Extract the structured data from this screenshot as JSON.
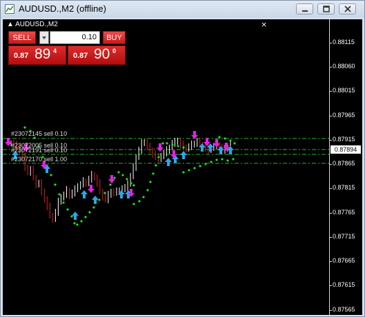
{
  "window": {
    "title": "AUDUSD.,M2 (offline)"
  },
  "chart": {
    "symbol_label": "AUDUSD.,M2",
    "close_glyph": "×",
    "panel": {
      "sell_label": "SELL",
      "buy_label": "BUY",
      "lot_value": "0.10",
      "bid": {
        "prefix": "0.87",
        "big": "89",
        "sup": "4"
      },
      "ask": {
        "prefix": "0.87",
        "big": "90",
        "sup": "0"
      }
    },
    "price_ticks": [
      "0.88115",
      "0.88060",
      "0.88015",
      "0.87965",
      "0.87915",
      "0.87865",
      "0.87815",
      "0.87765",
      "0.87715",
      "0.87665",
      "0.87615",
      "0.87565"
    ],
    "current_price": "0.87894",
    "order_lines": [
      {
        "label": "#23072145 sell 0.10"
      },
      {
        "label": "#23072005 sell 0.10"
      },
      {
        "label": "#23072191 sell 0.10"
      },
      {
        "label": "#23072170 sell 1.00"
      }
    ],
    "colors": {
      "background": "#000000",
      "indicator": "#22e022",
      "buy_arrow": "#29a8e8",
      "sell_arrow": "#e81ee8",
      "order_line": "#22c022",
      "bear_candle": "#e02020",
      "bull_candle": "#ffffff"
    }
  }
}
